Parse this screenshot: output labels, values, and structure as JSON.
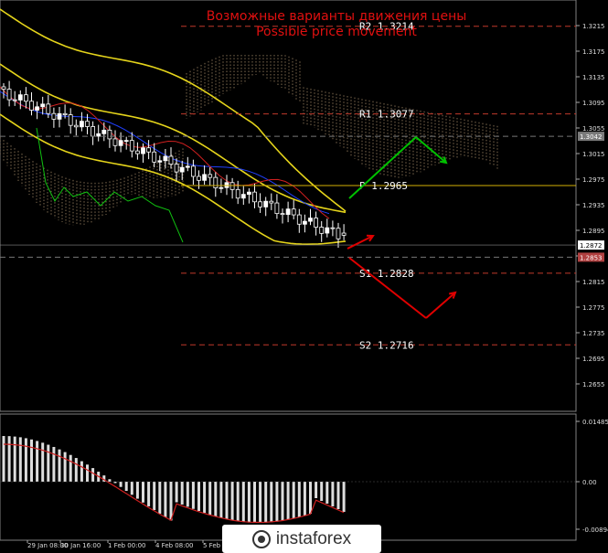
{
  "title": {
    "ru": "Возможные варианты движения цены",
    "en": "Possible price movement"
  },
  "levels": [
    {
      "label": "R2 1.3214",
      "value": 1.3214,
      "color": "#c0392b"
    },
    {
      "label": "R1 1.3077",
      "value": 1.3077,
      "color": "#c0392b"
    },
    {
      "label": "P 1.2965",
      "value": 1.2965,
      "color": "#d4b106"
    },
    {
      "label": "S1 1.2828",
      "value": 1.2828,
      "color": "#c0392b"
    },
    {
      "label": "S2 1.2716",
      "value": 1.2716,
      "color": "#c0392b"
    }
  ],
  "price_axis": {
    "ticks": [
      "1.3215",
      "1.3175",
      "1.3135",
      "1.3095",
      "1.3055",
      "1.3015",
      "1.2975",
      "1.2935",
      "1.2895",
      "1.2855",
      "1.2815",
      "1.2775",
      "1.2735",
      "1.2695",
      "1.2655"
    ],
    "ymin": 1.2655,
    "ymax": 1.3215,
    "tags": [
      {
        "label": "1.3042",
        "value": 1.3042,
        "bg": "#7a7a7a",
        "fg": "#ffffff"
      },
      {
        "label": "1.2872",
        "value": 1.2872,
        "bg": "#ffffff",
        "fg": "#000000"
      },
      {
        "label": "1.2853",
        "value": 1.2853,
        "bg": "#b04040",
        "fg": "#ffffff"
      }
    ]
  },
  "osc_axis": {
    "ticks": [
      "0.01485",
      "0.00",
      "-0.00894"
    ]
  },
  "time_axis": {
    "labels": [
      "29 Jan 08:00",
      "30 Jan 16:00",
      "1 Feb 00:00",
      "4 Feb 08:00",
      "5 Feb"
    ]
  },
  "watermark": "instaforex",
  "colors": {
    "level_red": "#c0392b",
    "pivot": "#d4b106",
    "bollinger": "#e5d41b",
    "ichimoku_cloud": "#c8a880",
    "arrow_green": "#00c000",
    "arrow_red": "#e00000",
    "macd_signal": "#d02020"
  }
}
